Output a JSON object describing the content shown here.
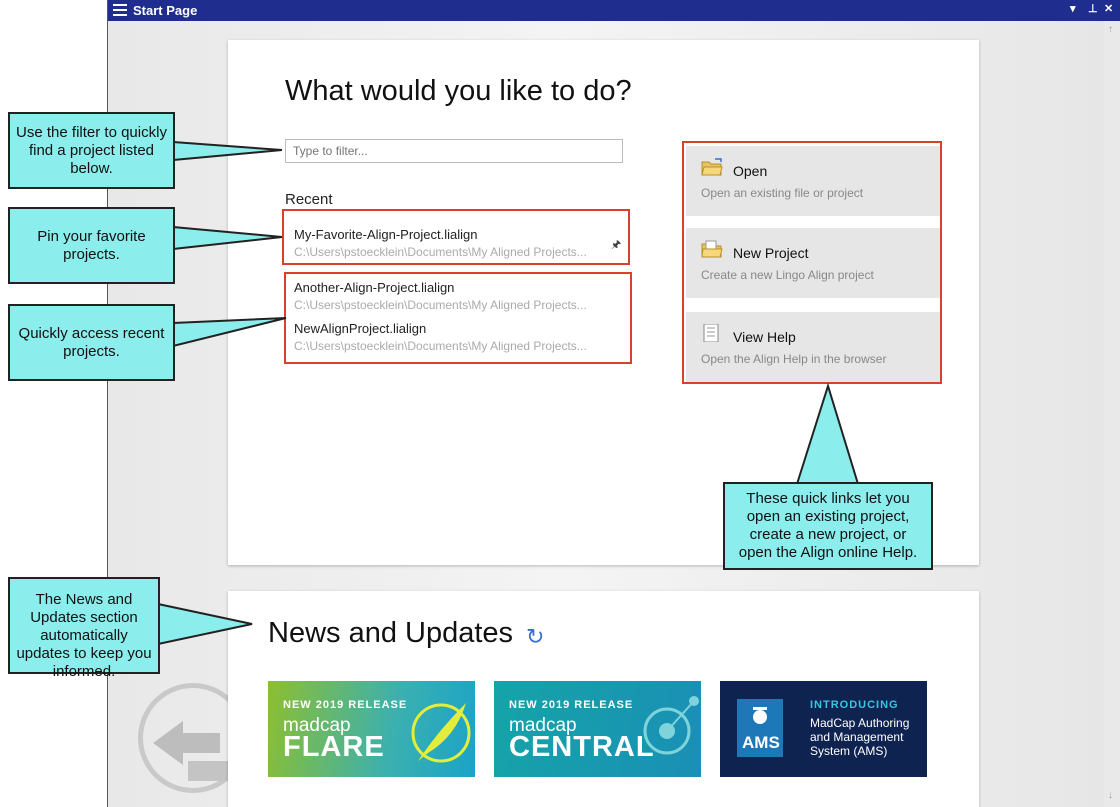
{
  "window": {
    "title": "Start Page",
    "dropdown_glyph": "▾",
    "pin_glyph": "⊥",
    "close_glyph": "✕",
    "scroll_up_glyph": "↑",
    "scroll_down_glyph": "↓"
  },
  "main": {
    "heading": "What would you like to do?",
    "filter_placeholder": "Type to filter...",
    "recent_label": "Recent",
    "projects": [
      {
        "name": "My-Favorite-Align-Project.lialign",
        "path": "C:\\Users\\pstoecklein\\Documents\\My Aligned Projects..."
      },
      {
        "name": "Another-Align-Project.lialign",
        "path": "C:\\Users\\pstoecklein\\Documents\\My Aligned Projects..."
      },
      {
        "name": "NewAlignProject.lialign",
        "path": "C:\\Users\\pstoecklein\\Documents\\My Aligned Projects..."
      }
    ],
    "quick_links": [
      {
        "label": "Open",
        "desc": "Open an existing file or project",
        "icon": "open-folder-icon"
      },
      {
        "label": "New Project",
        "desc": "Create a new Lingo Align project",
        "icon": "new-project-icon"
      },
      {
        "label": "View Help",
        "desc": "Open the Align Help in the browser",
        "icon": "help-document-icon"
      }
    ]
  },
  "news": {
    "title": "News and Updates",
    "tiles": [
      {
        "badge": "NEW 2019 RELEASE",
        "brand": "madcap",
        "product": "FLARE",
        "colors": [
          "#8dbf2f",
          "#1aa3c8"
        ]
      },
      {
        "badge": "NEW 2019 RELEASE",
        "brand": "madcap",
        "product": "CENTRAL",
        "colors": [
          "#15a4a8",
          "#1a8fb5"
        ]
      },
      {
        "badge": "INTRODUCING",
        "brand": "AMS",
        "product": "MadCap Authoring and Management System (AMS)",
        "colors": [
          "#0f2350",
          "#0f2350"
        ]
      }
    ]
  },
  "callouts": {
    "filter": "Use the filter to quickly find a project listed below.",
    "pin": "Pin your favorite projects.",
    "recent": "Quickly access recent projects.",
    "news": "The News and Updates section automatically updates to keep you informed.",
    "quicklinks": "These quick links let you open an existing project, create a new project, or open the Align online Help."
  },
  "colors": {
    "titlebar": "#1f2d8f",
    "callout_fill": "#8ceded",
    "highlight_border": "#d9412b"
  }
}
